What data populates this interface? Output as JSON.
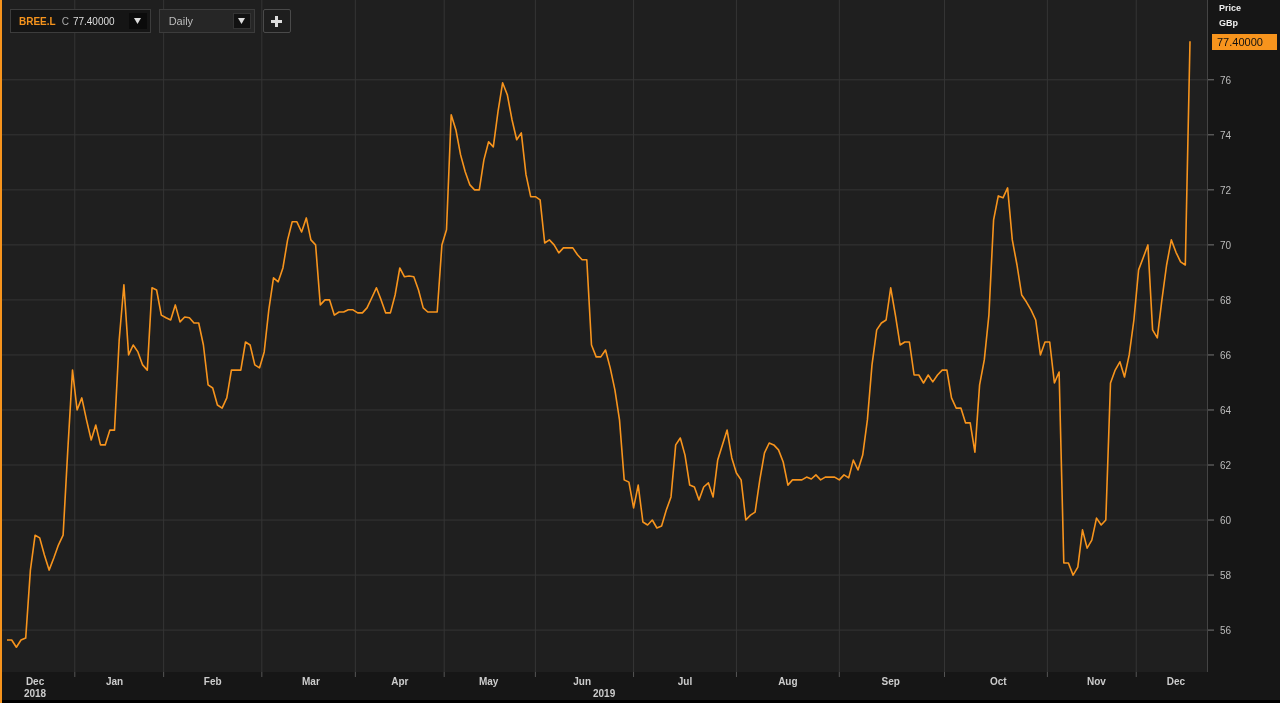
{
  "toolbar": {
    "symbol": "BREE.L",
    "quote_label": "C",
    "quote": "77.40000",
    "interval": "Daily"
  },
  "chart": {
    "axis_title": "Price",
    "unit": "GBp",
    "last_price": "77.40000",
    "year_labels": [
      "2018",
      "2019"
    ],
    "chart_data": {
      "type": "line",
      "grid": true,
      "ylim": [
        54.55,
        78.9
      ],
      "yticks": [
        56,
        58,
        60,
        62,
        64,
        66,
        68,
        70,
        72,
        74,
        76
      ],
      "categories": [
        null,
        null,
        null,
        null,
        null,
        null,
        "Dec",
        null,
        null,
        null,
        null,
        null,
        null,
        null,
        null,
        null,
        null,
        null,
        null,
        null,
        null,
        null,
        null,
        "Jan",
        null,
        null,
        null,
        null,
        null,
        null,
        null,
        null,
        null,
        null,
        null,
        null,
        null,
        null,
        null,
        null,
        null,
        null,
        null,
        null,
        "Feb",
        null,
        null,
        null,
        null,
        null,
        null,
        null,
        null,
        null,
        null,
        null,
        null,
        null,
        null,
        null,
        null,
        null,
        null,
        null,
        null,
        "Mar",
        null,
        null,
        null,
        null,
        null,
        null,
        null,
        null,
        null,
        null,
        null,
        null,
        null,
        null,
        null,
        null,
        null,
        null,
        "Apr",
        null,
        null,
        null,
        null,
        null,
        null,
        null,
        null,
        null,
        null,
        null,
        null,
        null,
        null,
        null,
        null,
        null,
        null,
        "May",
        null,
        null,
        null,
        null,
        null,
        null,
        null,
        null,
        null,
        null,
        null,
        null,
        null,
        null,
        null,
        null,
        null,
        null,
        null,
        "Jun",
        null,
        null,
        null,
        null,
        null,
        null,
        null,
        null,
        null,
        null,
        null,
        null,
        null,
        null,
        null,
        null,
        null,
        null,
        null,
        null,
        null,
        "Jul",
        null,
        null,
        null,
        null,
        null,
        null,
        null,
        null,
        null,
        null,
        null,
        null,
        null,
        null,
        null,
        null,
        null,
        null,
        null,
        null,
        null,
        "Aug",
        null,
        null,
        null,
        null,
        null,
        null,
        null,
        null,
        null,
        null,
        null,
        null,
        null,
        null,
        null,
        null,
        null,
        null,
        null,
        null,
        null,
        "Sep",
        null,
        null,
        null,
        null,
        null,
        null,
        null,
        null,
        null,
        null,
        null,
        null,
        null,
        null,
        null,
        null,
        null,
        null,
        null,
        null,
        null,
        null,
        "Oct",
        null,
        null,
        null,
        null,
        null,
        null,
        null,
        null,
        null,
        null,
        null,
        null,
        null,
        null,
        null,
        null,
        null,
        null,
        null,
        null,
        "Nov",
        null,
        null,
        null,
        null,
        null,
        null,
        null,
        null,
        null,
        null,
        null,
        null,
        null,
        null,
        null,
        null,
        "Dec",
        null,
        null,
        null
      ],
      "series": [
        {
          "color": "#f7941d",
          "values": [
            55.64,
            55.64,
            55.38,
            55.64,
            55.71,
            58.18,
            59.45,
            59.35,
            58.73,
            58.18,
            58.62,
            59.09,
            59.45,
            62.55,
            65.45,
            64.0,
            64.44,
            63.64,
            62.91,
            63.45,
            62.73,
            62.73,
            63.27,
            63.27,
            66.55,
            68.55,
            66.0,
            66.36,
            66.11,
            65.64,
            65.45,
            68.44,
            68.36,
            67.45,
            67.35,
            67.27,
            67.82,
            67.2,
            67.38,
            67.35,
            67.16,
            67.16,
            66.36,
            64.91,
            64.8,
            64.18,
            64.07,
            64.44,
            65.45,
            65.45,
            65.45,
            66.47,
            66.36,
            65.64,
            65.53,
            66.11,
            67.64,
            68.8,
            68.66,
            69.16,
            70.18,
            70.84,
            70.84,
            70.47,
            70.98,
            70.18,
            70.0,
            67.82,
            68.0,
            68.0,
            67.45,
            67.56,
            67.56,
            67.64,
            67.64,
            67.53,
            67.53,
            67.71,
            68.07,
            68.44,
            68.0,
            67.53,
            67.53,
            68.18,
            69.16,
            68.84,
            68.87,
            68.84,
            68.36,
            67.71,
            67.56,
            67.56,
            67.56,
            70.0,
            70.55,
            74.73,
            74.18,
            73.27,
            72.66,
            72.18,
            72.0,
            72.0,
            73.09,
            73.75,
            73.56,
            74.84,
            75.89,
            75.46,
            74.55,
            73.82,
            74.07,
            72.55,
            71.75,
            71.75,
            71.64,
            70.07,
            70.18,
            70.0,
            69.71,
            69.89,
            69.89,
            69.89,
            69.64,
            69.46,
            69.46,
            66.36,
            65.93,
            65.93,
            66.18,
            65.53,
            64.73,
            63.64,
            61.46,
            61.38,
            60.44,
            61.27,
            59.93,
            59.82,
            60.0,
            59.71,
            59.78,
            60.36,
            60.84,
            62.73,
            62.98,
            62.36,
            61.27,
            61.2,
            60.73,
            61.2,
            61.35,
            60.84,
            62.18,
            62.73,
            63.27,
            62.26,
            61.71,
            61.46,
            60.0,
            60.18,
            60.29,
            61.46,
            62.44,
            62.8,
            62.73,
            62.55,
            62.11,
            61.27,
            61.46,
            61.46,
            61.46,
            61.56,
            61.49,
            61.64,
            61.46,
            61.56,
            61.56,
            61.56,
            61.46,
            61.64,
            61.53,
            62.18,
            61.82,
            62.36,
            63.64,
            65.64,
            66.91,
            67.16,
            67.27,
            68.44,
            67.45,
            66.36,
            66.47,
            66.47,
            65.27,
            65.27,
            64.98,
            65.27,
            65.02,
            65.27,
            65.45,
            65.45,
            64.44,
            64.07,
            64.07,
            63.53,
            63.53,
            62.47,
            64.91,
            65.82,
            67.45,
            70.91,
            71.78,
            71.71,
            72.07,
            70.18,
            69.27,
            68.18,
            67.93,
            67.64,
            67.27,
            66.0,
            66.47,
            66.47,
            64.98,
            65.38,
            58.44,
            58.44,
            58.0,
            58.29,
            59.64,
            58.98,
            59.27,
            60.07,
            59.82,
            60.0,
            64.98,
            65.45,
            65.75,
            65.2,
            66.0,
            67.27,
            69.09,
            69.53,
            70.0,
            66.91,
            66.62,
            68.0,
            69.27,
            70.18,
            69.73,
            69.38,
            69.27,
            77.4
          ]
        }
      ]
    }
  }
}
